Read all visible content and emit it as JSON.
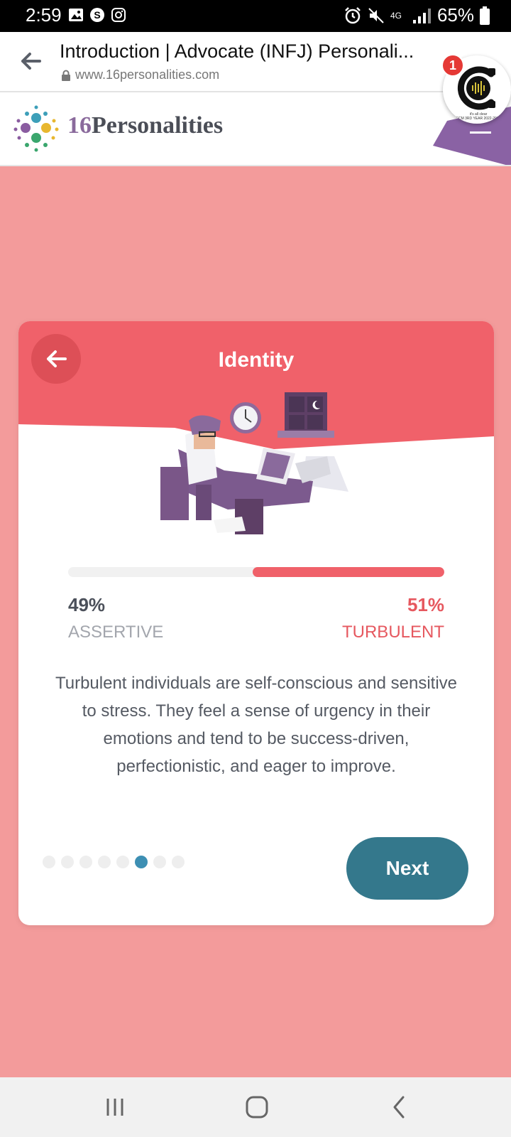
{
  "status_bar": {
    "time": "2:59",
    "battery": "65%",
    "network": "4G"
  },
  "browser": {
    "page_title": "Introduction | Advocate (INFJ) Personali...",
    "url": "www.16personalities.com",
    "notification_count": "1"
  },
  "site": {
    "logo_number": "16",
    "logo_word": "Personalities"
  },
  "bubble": {
    "caption_line1": "it's all clear",
    "caption_line2": "ECM 3RD YEAR 2022-2023"
  },
  "card": {
    "title": "Identity",
    "left_percent": "49%",
    "left_label": "ASSERTIVE",
    "right_percent": "51%",
    "right_label": "TURBULENT",
    "turbulent_share": 0.51,
    "description": "Turbulent individuals are self-conscious and sensitive to stress. They feel a sense of urgency in their emotions and tend to be success-driven, perfectionistic, and eager to improve.",
    "next_label": "Next",
    "page_dots_total": 8,
    "page_dot_active": 6
  },
  "colors": {
    "background": "#f39b9b",
    "accent_red": "#f0616a",
    "next_button": "#34788c",
    "active_dot": "#3d8fb3"
  }
}
